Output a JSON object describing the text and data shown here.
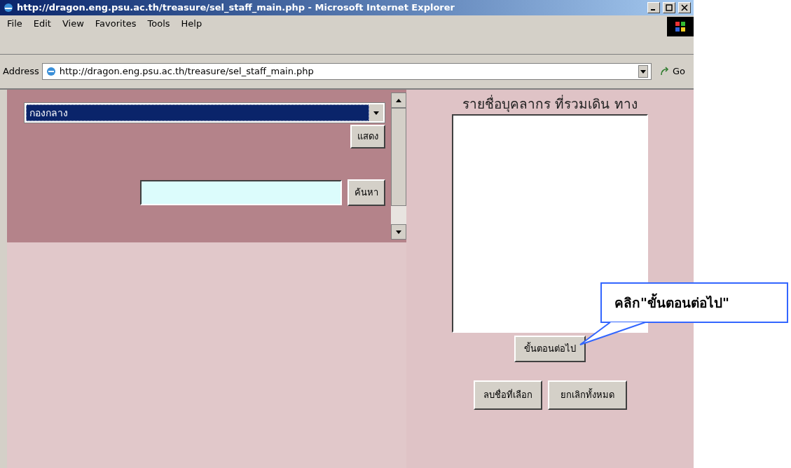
{
  "window": {
    "title": "http://dragon.eng.psu.ac.th/treasure/sel_staff_main.php - Microsoft Internet Explorer"
  },
  "menu": [
    "File",
    "Edit",
    "View",
    "Favorites",
    "Tools",
    "Help"
  ],
  "address_bar": {
    "label": "Address",
    "value": "http://dragon.eng.psu.ac.th/treasure/sel_staff_main.php",
    "go": "Go"
  },
  "left_frame": {
    "dropdown": {
      "value": "กองกลาง"
    },
    "show_button": "แสดง",
    "search_button": "ค้นหา"
  },
  "right_frame": {
    "title": "รายชื่อบุคลากร ที่รวมเดิน ทาง",
    "next_button": "ขั้นตอนต่อไป",
    "delete_button": "ลบชื่อที่เลือก",
    "cancel_button": "ยกเลิกทั้งหมด"
  },
  "callout": {
    "text": "คลิก\"ขั้นตอนต่อไป\""
  }
}
